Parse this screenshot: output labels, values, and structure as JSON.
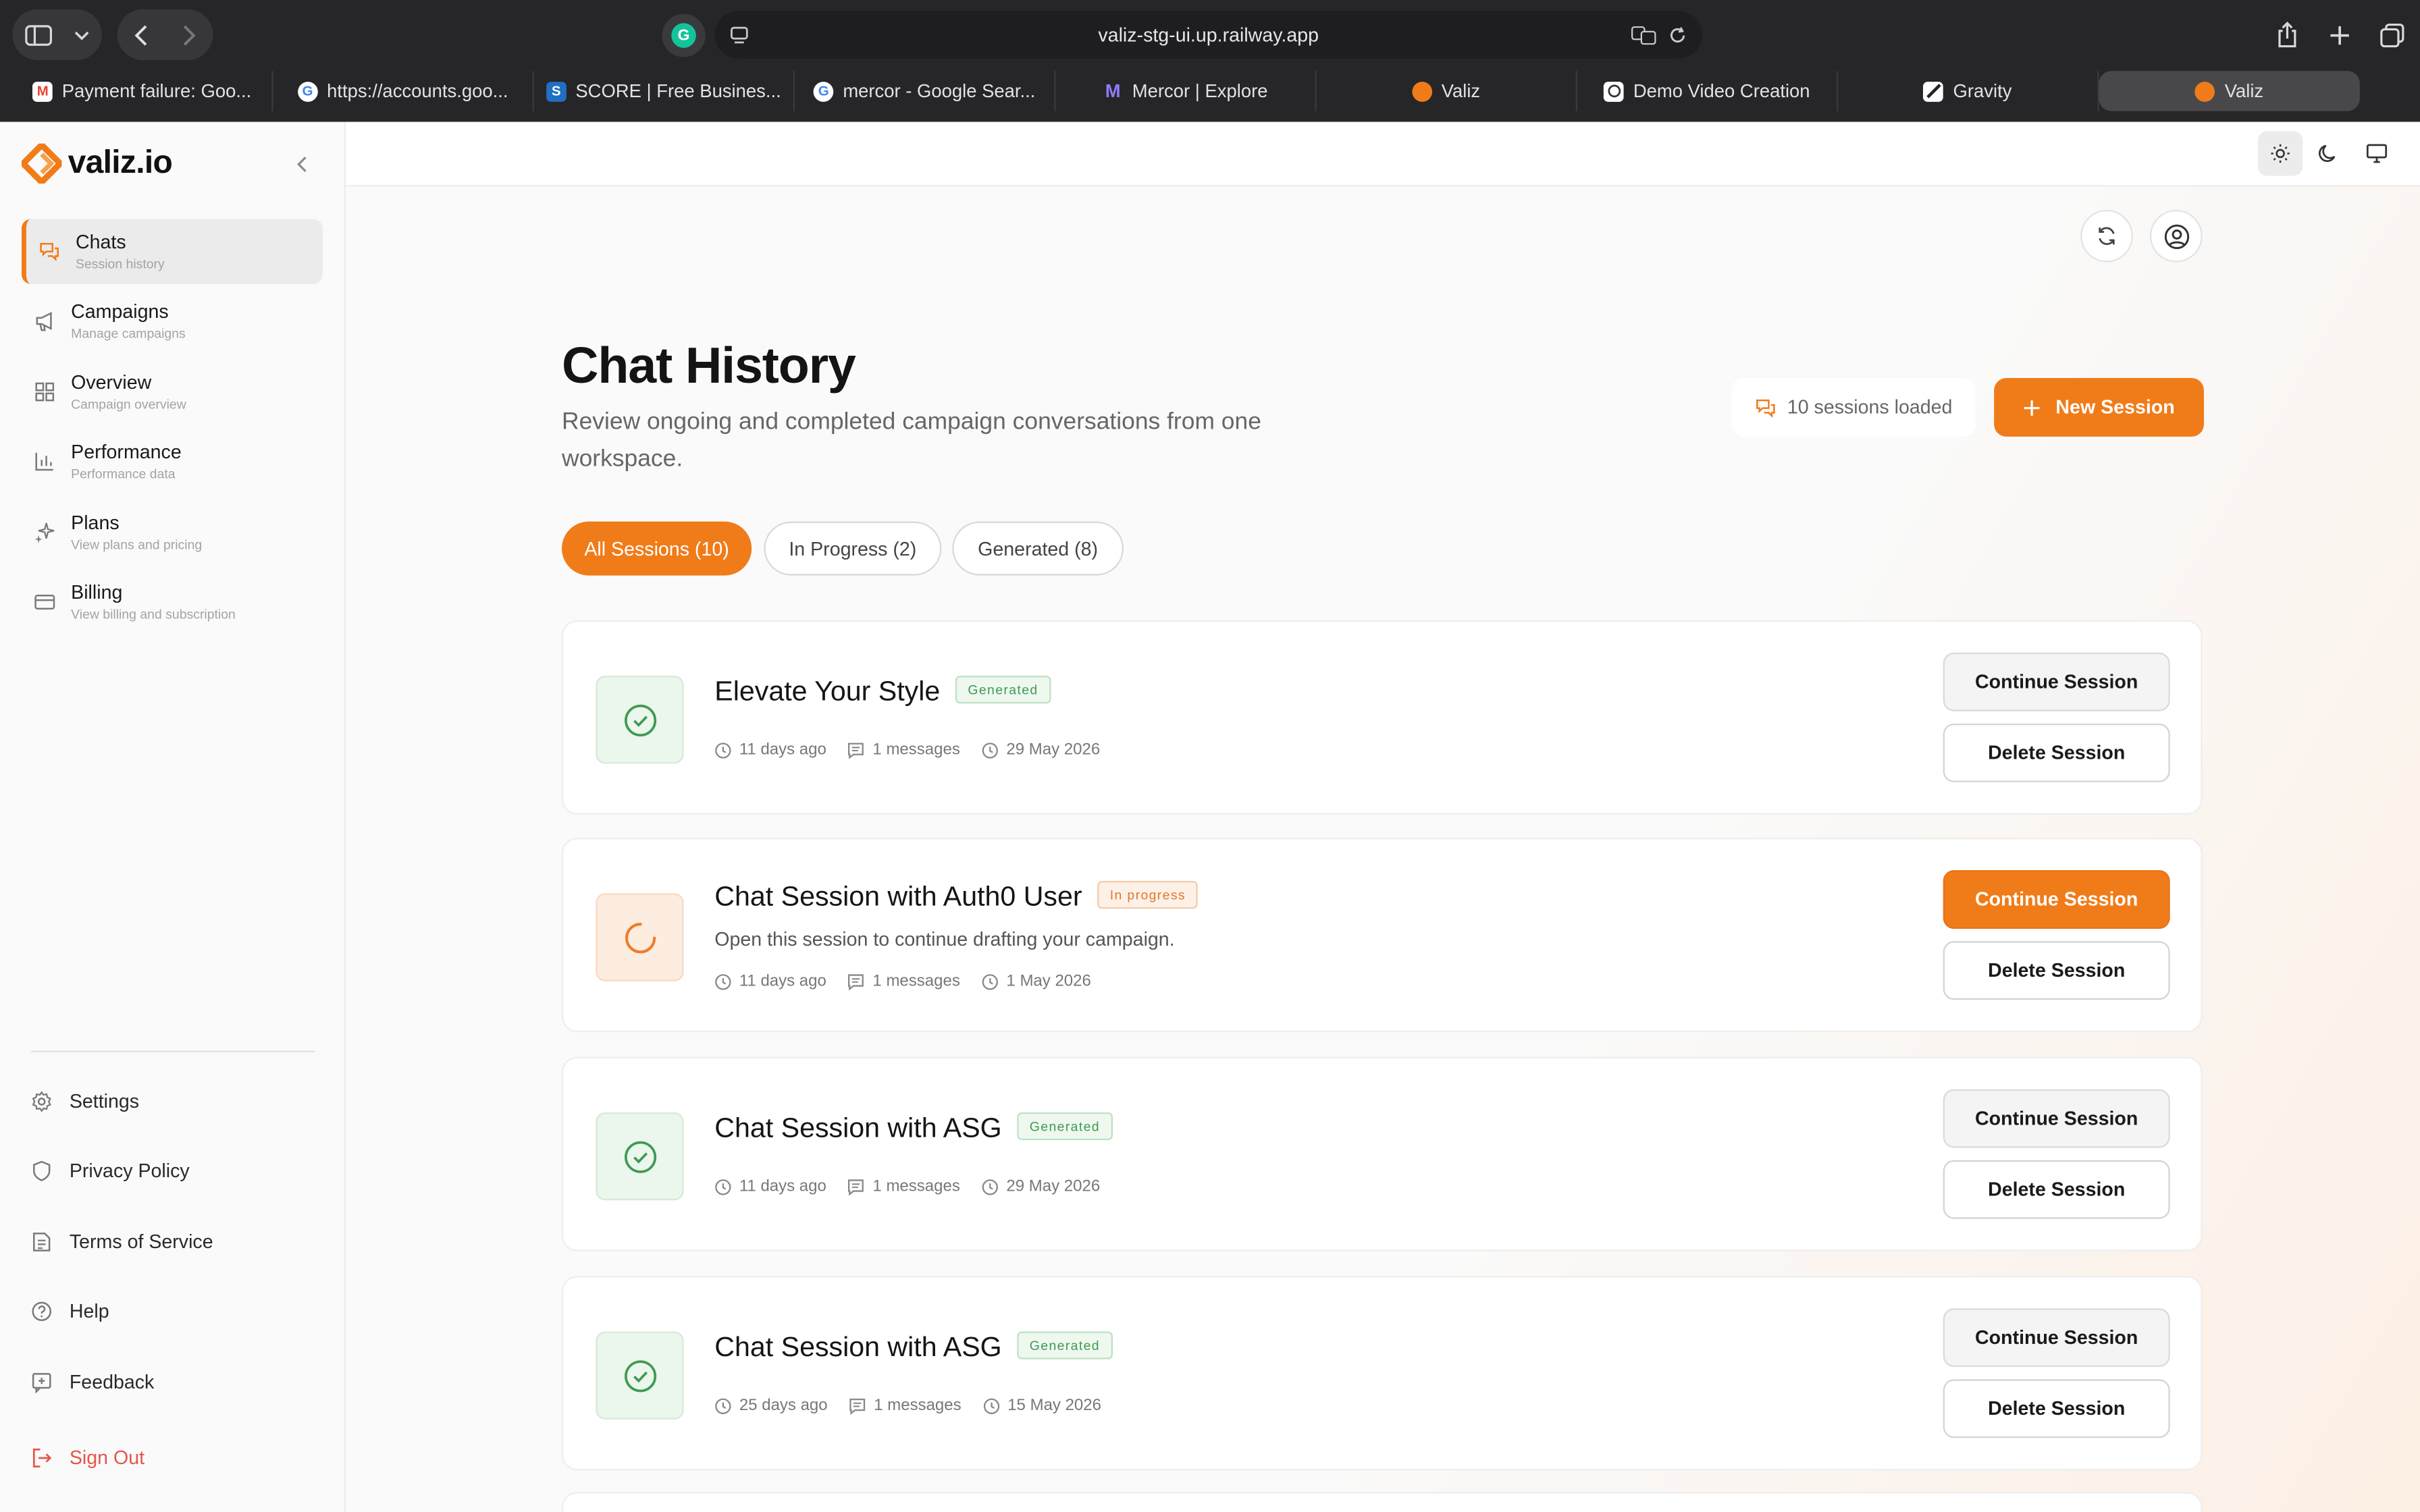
{
  "browser": {
    "url": "valiz-stg-ui.up.railway.app",
    "tabs": [
      {
        "label": "Payment failure: Goo...",
        "favicon": "gmail-icon",
        "color": "#ea4335"
      },
      {
        "label": "https://accounts.goo...",
        "favicon": "google-icon",
        "color": "#4285f4"
      },
      {
        "label": "SCORE | Free Busines...",
        "favicon": "score-icon",
        "color": "#1f6fc2"
      },
      {
        "label": "mercor - Google Sear...",
        "favicon": "google-icon",
        "color": "#4285f4"
      },
      {
        "label": "Mercor | Explore",
        "favicon": "mercor-icon",
        "color": "#6b5cf0"
      },
      {
        "label": "Valiz",
        "favicon": "valiz-icon",
        "color": "#f07c19"
      },
      {
        "label": "Demo Video Creation",
        "favicon": "openai-icon",
        "color": "#555555"
      },
      {
        "label": "Gravity",
        "favicon": "gravity-icon",
        "color": "#444444"
      },
      {
        "label": "Valiz",
        "favicon": "valiz-icon",
        "color": "#f07c19",
        "active": true
      }
    ]
  },
  "brand": {
    "name": "valiz.io",
    "accent": "#f07c19"
  },
  "sidebar": {
    "items": [
      {
        "label": "Chats",
        "sub": "Session history",
        "icon": "chat-icon",
        "active": true
      },
      {
        "label": "Campaigns",
        "sub": "Manage campaigns",
        "icon": "megaphone-icon"
      },
      {
        "label": "Overview",
        "sub": "Campaign overview",
        "icon": "grid-icon"
      },
      {
        "label": "Performance",
        "sub": "Performance data",
        "icon": "bar-chart-icon"
      },
      {
        "label": "Plans",
        "sub": "View plans and pricing",
        "icon": "sparkles-icon"
      },
      {
        "label": "Billing",
        "sub": "View billing and subscription",
        "icon": "credit-card-icon"
      }
    ],
    "footer": [
      {
        "label": "Settings",
        "icon": "gear-icon"
      },
      {
        "label": "Privacy Policy",
        "icon": "shield-icon"
      },
      {
        "label": "Terms of Service",
        "icon": "document-icon"
      },
      {
        "label": "Help",
        "icon": "help-icon"
      },
      {
        "label": "Feedback",
        "icon": "feedback-icon"
      }
    ],
    "signout": "Sign Out"
  },
  "header": {
    "title": "Chat History",
    "subtitle": "Review ongoing and completed campaign conversations from one workspace.",
    "sessions_loaded": "10 sessions loaded",
    "new_session": "New Session"
  },
  "filters": [
    {
      "label": "All Sessions (10)",
      "active": true
    },
    {
      "label": "In Progress (2)"
    },
    {
      "label": "Generated (8)"
    }
  ],
  "sessions": [
    {
      "title": "Elevate Your Style",
      "status": "Generated",
      "status_type": "gen",
      "description": "",
      "age": "11 days ago",
      "messages": "1 messages",
      "date": "29 May 2026",
      "continue_label": "Continue Session",
      "delete_label": "Delete Session"
    },
    {
      "title": "Chat Session with Auth0 User",
      "status": "In progress",
      "status_type": "prog",
      "description": "Open this session to continue drafting your campaign.",
      "age": "11 days ago",
      "messages": "1 messages",
      "date": "1 May 2026",
      "continue_label": "Continue Session",
      "delete_label": "Delete Session"
    },
    {
      "title": "Chat Session with ASG",
      "status": "Generated",
      "status_type": "gen",
      "description": "",
      "age": "11 days ago",
      "messages": "1 messages",
      "date": "29 May 2026",
      "continue_label": "Continue Session",
      "delete_label": "Delete Session"
    },
    {
      "title": "Chat Session with ASG",
      "status": "Generated",
      "status_type": "gen",
      "description": "",
      "age": "25 days ago",
      "messages": "1 messages",
      "date": "15 May 2026",
      "continue_label": "Continue Session",
      "delete_label": "Delete Session"
    }
  ]
}
